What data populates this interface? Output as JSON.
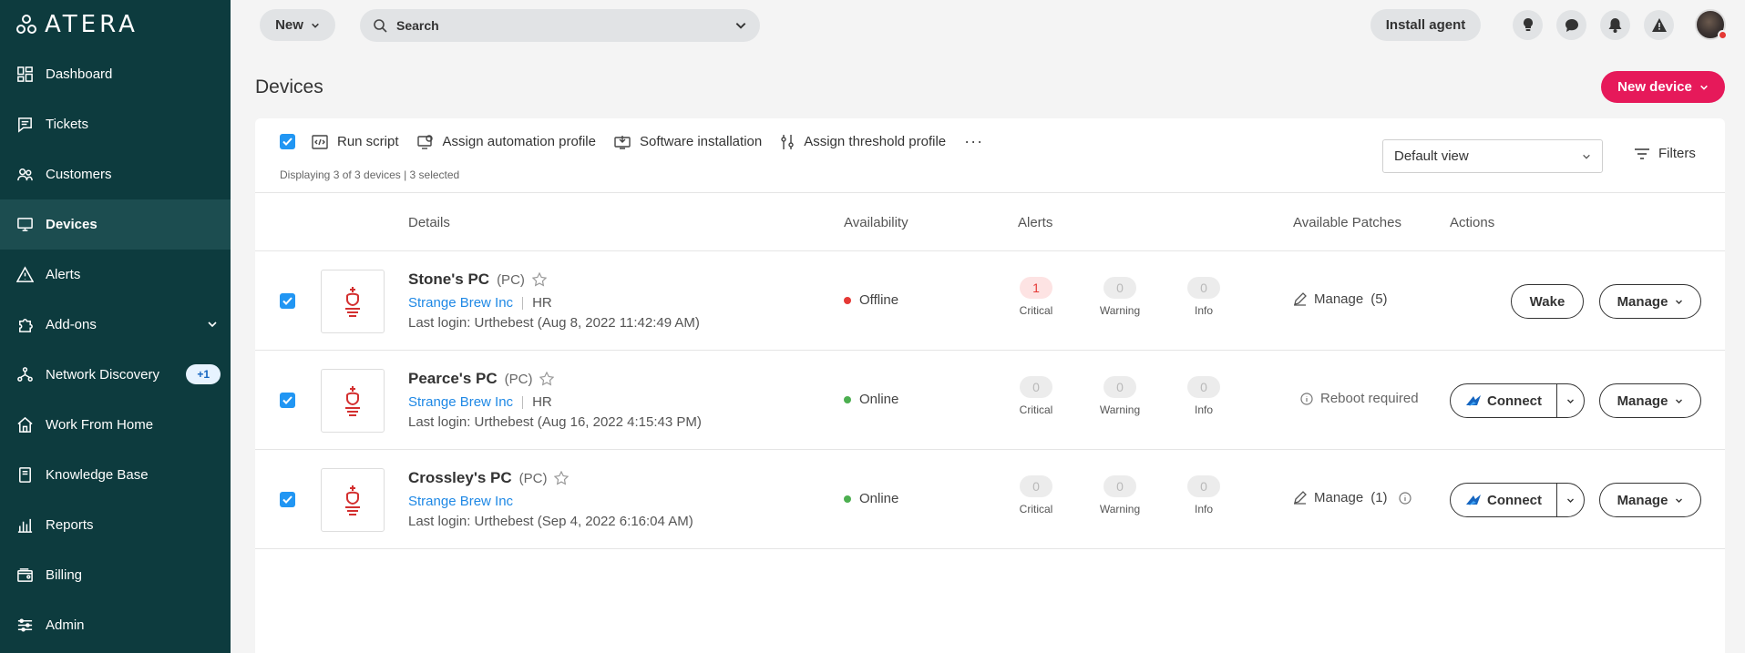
{
  "app": {
    "logo_text": "ATERA"
  },
  "sidebar": {
    "items": [
      {
        "label": "Dashboard",
        "icon": "dashboard-icon"
      },
      {
        "label": "Tickets",
        "icon": "tickets-icon"
      },
      {
        "label": "Customers",
        "icon": "customers-icon"
      },
      {
        "label": "Devices",
        "icon": "devices-icon",
        "active": true
      },
      {
        "label": "Alerts",
        "icon": "alerts-icon"
      },
      {
        "label": "Add-ons",
        "icon": "addons-icon"
      },
      {
        "label": "Network Discovery",
        "icon": "network-icon",
        "badge": "+1"
      },
      {
        "label": "Work From Home",
        "icon": "home-icon"
      },
      {
        "label": "Knowledge Base",
        "icon": "book-icon"
      },
      {
        "label": "Reports",
        "icon": "reports-icon"
      },
      {
        "label": "Billing",
        "icon": "billing-icon"
      },
      {
        "label": "Admin",
        "icon": "admin-icon"
      }
    ]
  },
  "topbar": {
    "new_label": "New",
    "search_placeholder": "Search",
    "install_label": "Install agent",
    "icons": [
      "lightbulb-icon",
      "chat-icon",
      "bell-icon",
      "warning-icon"
    ]
  },
  "page": {
    "title": "Devices",
    "new_device_label": "New device"
  },
  "toolbar": {
    "actions": [
      "Run script",
      "Assign automation profile",
      "Software installation",
      "Assign threshold profile"
    ],
    "more": "···",
    "displaying": "Displaying 3 of 3 devices | 3 selected",
    "view": "Default view",
    "filters_label": "Filters"
  },
  "table": {
    "headers": {
      "details": "Details",
      "availability": "Availability",
      "alerts": "Alerts",
      "patches": "Available Patches",
      "actions": "Actions"
    },
    "rows": [
      {
        "name": "Stone's PC",
        "type": "(PC)",
        "customer": "Strange Brew Inc",
        "dept": "HR",
        "login": "Last login: Urthebest (Aug 8, 2022 11:42:49 AM)",
        "status": "Offline",
        "status_color": "#e53935",
        "critical": "1",
        "warning": "0",
        "info": "0",
        "critical_label": "Critical",
        "warning_label": "Warning",
        "info_label": "Info",
        "patches": "Manage",
        "patches_count": "(5)",
        "primary_action": "Wake",
        "manage_label": "Manage"
      },
      {
        "name": "Pearce's PC",
        "type": "(PC)",
        "customer": "Strange Brew Inc",
        "dept": "HR",
        "login": "Last login: Urthebest (Aug 16, 2022 4:15:43 PM)",
        "status": "Online",
        "status_color": "#4caf50",
        "critical": "0",
        "warning": "0",
        "info": "0",
        "critical_label": "Critical",
        "warning_label": "Warning",
        "info_label": "Info",
        "patches": "Reboot required",
        "primary_action": "Connect",
        "manage_label": "Manage"
      },
      {
        "name": "Crossley's PC",
        "type": "(PC)",
        "customer": "Strange Brew Inc",
        "login": "Last login: Urthebest (Sep 4, 2022 6:16:04 AM)",
        "status": "Online",
        "status_color": "#4caf50",
        "critical": "0",
        "warning": "0",
        "info": "0",
        "critical_label": "Critical",
        "warning_label": "Warning",
        "info_label": "Info",
        "patches": "Manage",
        "patches_count": "(1)",
        "primary_action": "Connect",
        "manage_label": "Manage"
      }
    ]
  },
  "colors": {
    "sidebar": "#0d3b3e",
    "accent": "#e6195a",
    "link": "#1e88e5",
    "checkbox": "#2196f3"
  }
}
